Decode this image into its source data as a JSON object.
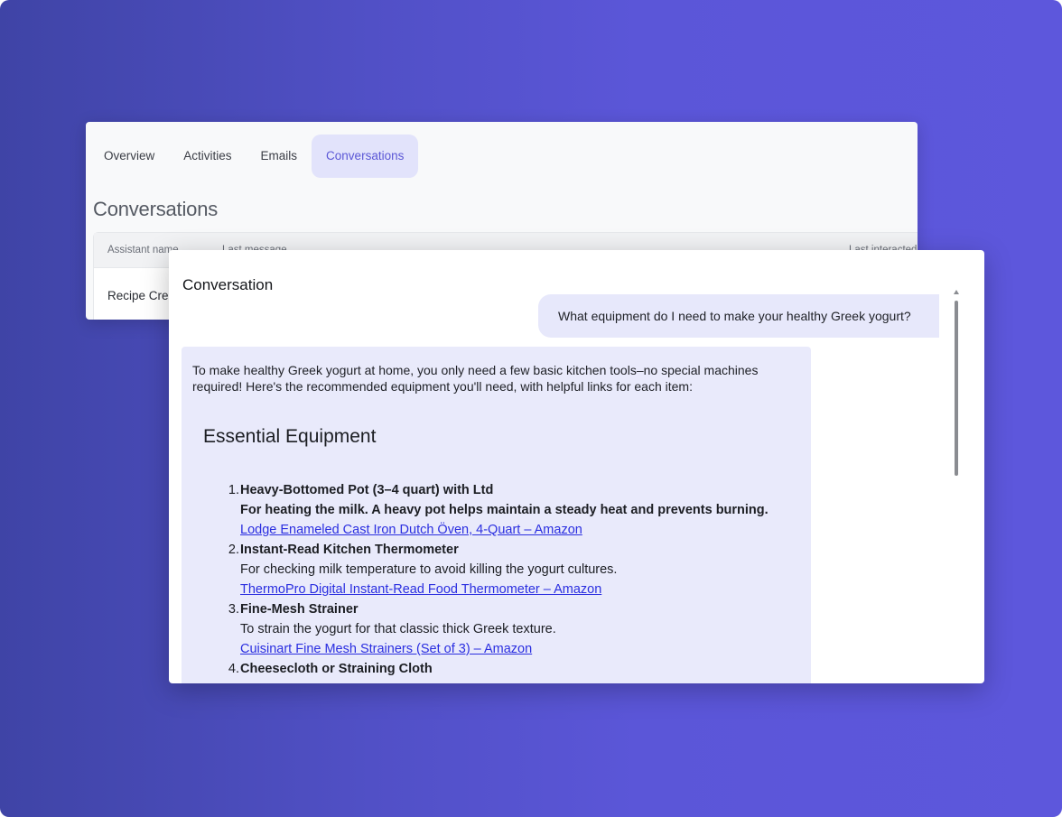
{
  "tabs": [
    {
      "label": "Overview"
    },
    {
      "label": "Activities"
    },
    {
      "label": "Emails"
    },
    {
      "label": "Conversations",
      "active": true
    }
  ],
  "section_title": "Conversations",
  "table": {
    "headers": [
      "Assistant name",
      "Last message",
      "Last interacted"
    ],
    "rows": [
      {
        "assistant": "Recipe Cre"
      }
    ]
  },
  "modal": {
    "title": "Conversation",
    "user_message": "What equipment do I need to make your healthy Greek yogurt?",
    "assistant": {
      "intro": "To make healthy Greek yogurt at home, you only need a few basic kitchen tools–no special machines required! Here's the recommended equipment you'll need, with helpful links for each item:",
      "heading": "Essential Equipment",
      "items": [
        {
          "num": "1.",
          "name": "Heavy-Bottomed Pot (3–4 quart) with Ltd",
          "desc": "For heating the milk. A heavy pot helps maintain a steady heat and prevents burning.",
          "link": "Lodge Enameled Cast Iron Dutch Öven, 4-Quart – Amazon"
        },
        {
          "num": "2.",
          "name": "Instant-Read Kitchen Thermometer",
          "desc": "For checking milk temperature to avoid killing the yogurt cultures.",
          "link": "ThermoPro Digital Instant-Read Food Thermometer – Amazon"
        },
        {
          "num": "3.",
          "name": "Fine-Mesh Strainer",
          "desc": "To strain the yogurt for that classic thick Greek texture.",
          "link": "Cuisinart Fine Mesh Strainers (Set of 3) – Amazon"
        },
        {
          "num": "4.",
          "name": "Cheesecloth or Straining Cloth"
        }
      ]
    }
  },
  "colors": {
    "accent": "#5b57d6",
    "bubble": "#e9eafb",
    "link": "#2a2ee0",
    "background_gradient_start": "#3f44a6",
    "background_gradient_end": "#5d57dc"
  }
}
